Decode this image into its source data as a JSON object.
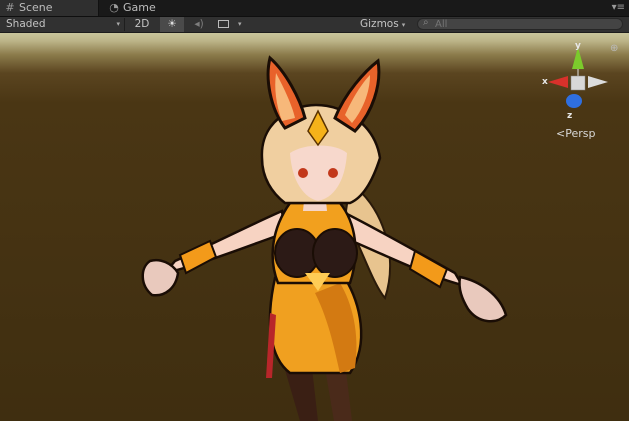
{
  "tabs": [
    {
      "label": "Scene",
      "icon": "grid-icon",
      "active": true
    },
    {
      "label": "Game",
      "icon": "game-icon",
      "active": false
    }
  ],
  "tab_menu_glyph": "▾≡",
  "toolbar": {
    "shading_mode": "Shaded",
    "dropdown_glyph": "▾",
    "btn_2d": "2D",
    "light_glyph": "☀",
    "audio_glyph": "◂)",
    "gizmos": "Gizmos",
    "search_placeholder": "All",
    "search_glyph": "⌕"
  },
  "gizmo": {
    "y_label": "y",
    "x_label": "x",
    "z_label": "z",
    "projection_label": "<Persp",
    "lock_glyph": "⊕"
  },
  "colors": {
    "axis_x": "#d8312b",
    "axis_y": "#7ccb2c",
    "axis_z": "#2f6fe0",
    "ground": "#3f2e10",
    "horizon": "#c9c59b"
  }
}
